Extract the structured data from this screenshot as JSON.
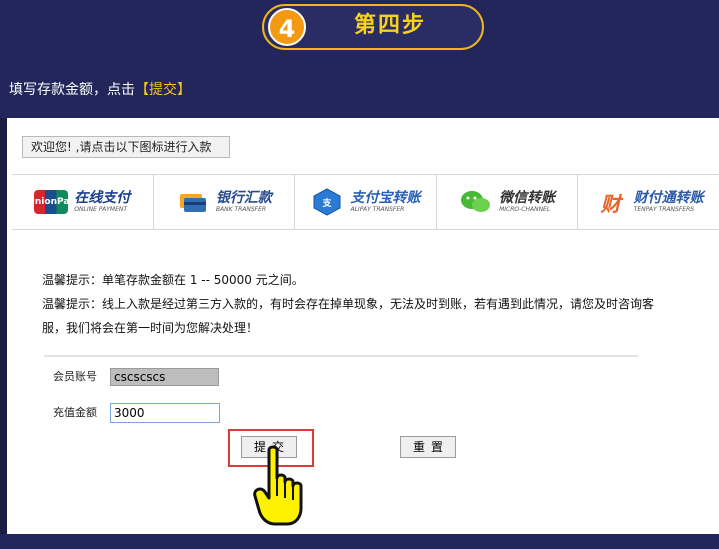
{
  "step": {
    "number": "4",
    "title": "第四步"
  },
  "instruction": {
    "text": "填写存款金额，点击",
    "highlight": "【提交】"
  },
  "welcome": "欢迎您! ,请点击以下图标进行入款",
  "payments": [
    {
      "name": "在线支付",
      "sub": "ONLINE PAYMENT",
      "logo": "UnionPay 银联",
      "icon": "unionpay-icon",
      "color": "#1a3f8f"
    },
    {
      "name": "银行汇款",
      "sub": "BANK TRANSFER",
      "logo": "",
      "icon": "bank-card-icon",
      "color": "#2a4c8f"
    },
    {
      "name": "支付宝转账",
      "sub": "ALIPAY TRANSFER",
      "logo": "支付宝",
      "icon": "alipay-icon",
      "color": "#2a60b8"
    },
    {
      "name": "微信转账",
      "sub": "MICRO-CHANNEL",
      "logo": "",
      "icon": "wechat-icon",
      "color": "#333333"
    },
    {
      "name": "财付通转账",
      "sub": "TENPAY TRANSFERS",
      "logo": "财",
      "icon": "tenpay-icon",
      "color": "#2c5aa8"
    }
  ],
  "notice": {
    "line1": "温馨提示：单笔存款金额在 1 -- 50000 元之间。",
    "line2": "温馨提示：线上入款是经过第三方入款的，有时会存在掉单现象，无法及时到账，若有遇到此情况，请您及时咨询客",
    "line3": "服，我们将会在第一时间为您解决处理！"
  },
  "form": {
    "account_label": "会员账号",
    "account_value": "cscscscs",
    "amount_label": "充值金额",
    "amount_value": "3000",
    "submit_label": "提交",
    "reset_label": "重置"
  },
  "colors": {
    "background": "#23265a",
    "accent": "#f2b51b",
    "highlight": "#f7c51c",
    "callout": "#e03a3a"
  }
}
